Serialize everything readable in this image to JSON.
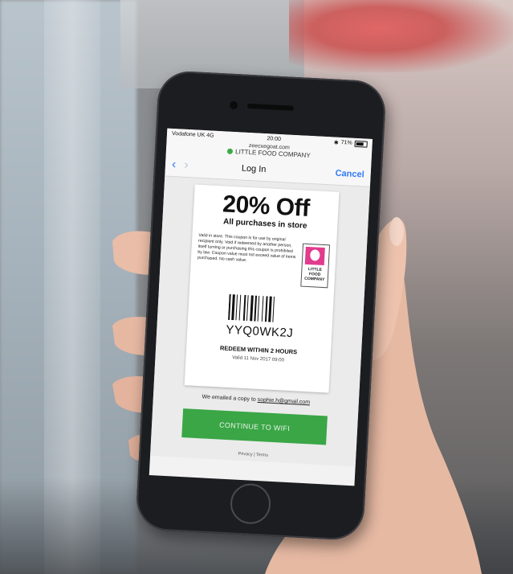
{
  "status_bar": {
    "carrier": "Vodafone UK  4G",
    "time": "20:00",
    "battery": "71%"
  },
  "url": {
    "domain": "zeecxegoat.com",
    "site": "LITTLE FOOD COMPANY"
  },
  "nav": {
    "title": "Log In",
    "cancel": "Cancel"
  },
  "coupon": {
    "headline": "20% Off",
    "subhead": "All purchases in store",
    "terms": "Valid in store. This coupon is for use by original recipient only. Void if redeemed by another person, itself turning or purchasing this coupon is prohibited by law. Coupon value must not exceed value of items purchased. No cash value.",
    "logo_text": "LITTLE FOOD COMPANY",
    "code": "YYQ0WK2J",
    "redeem": "REDEEM WITHIN 2 HOURS",
    "valid": "Valid 11 Nov 2017 09:00"
  },
  "emailed": {
    "prefix": "We emailed a copy to ",
    "address": "sophie.h@gmail.com"
  },
  "continue_label": "CONTINUE TO WIFI",
  "footer": "Privacy | Terms",
  "colors": {
    "ios_blue": "#2f7cf6",
    "button_green": "#3aa646",
    "logo_pink": "#e23b8e"
  }
}
